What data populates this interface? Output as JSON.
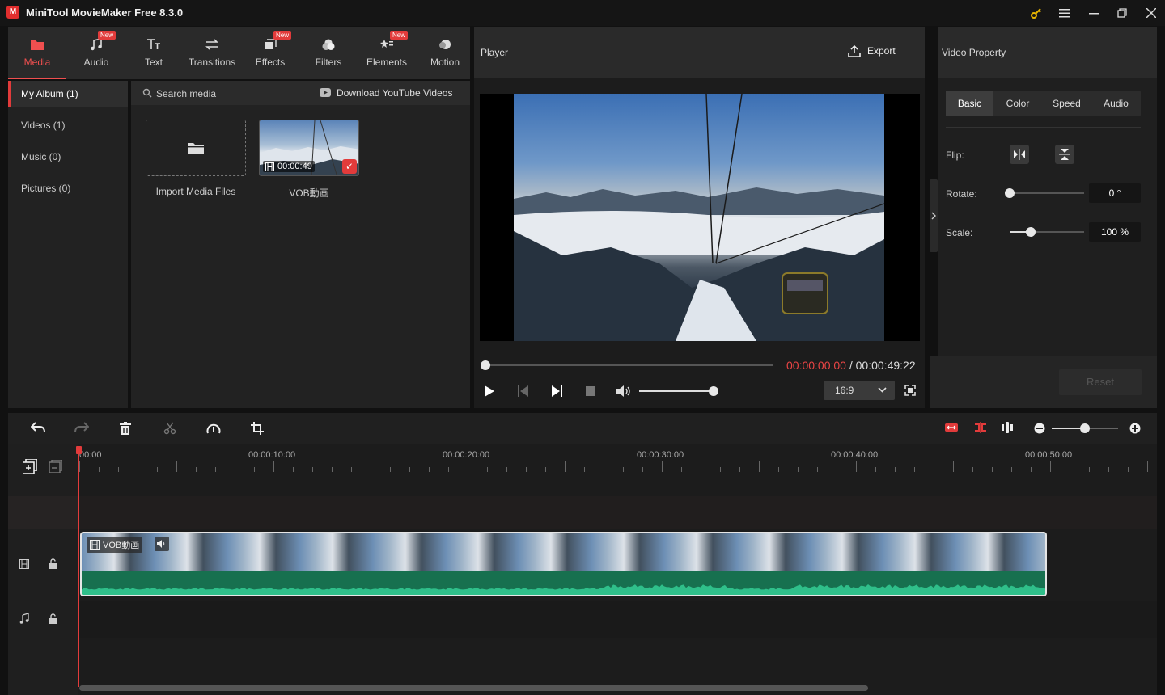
{
  "app": {
    "title": "MiniTool MovieMaker Free 8.3.0",
    "logo_letter": "M"
  },
  "window_controls": {
    "key": "key-icon",
    "menu": "menu-icon",
    "minimize": "minimize-icon",
    "maximize": "maximize-icon",
    "close": "close-icon"
  },
  "toolbar": {
    "items": [
      {
        "label": "Media",
        "icon": "media-icon",
        "new": false,
        "active": true
      },
      {
        "label": "Audio",
        "icon": "music-icon",
        "new": true,
        "active": false
      },
      {
        "label": "Text",
        "icon": "text-icon",
        "new": false,
        "active": false
      },
      {
        "label": "Transitions",
        "icon": "transitions-icon",
        "new": false,
        "active": false
      },
      {
        "label": "Effects",
        "icon": "effects-icon",
        "new": true,
        "active": false
      },
      {
        "label": "Filters",
        "icon": "filters-icon",
        "new": false,
        "active": false
      },
      {
        "label": "Elements",
        "icon": "elements-icon",
        "new": true,
        "active": false
      },
      {
        "label": "Motion",
        "icon": "motion-icon",
        "new": false,
        "active": false
      }
    ],
    "new_badge": "New"
  },
  "sidebar": {
    "items": [
      {
        "label": "My Album (1)",
        "active": true
      },
      {
        "label": "Videos (1)",
        "active": false
      },
      {
        "label": "Music (0)",
        "active": false
      },
      {
        "label": "Pictures (0)",
        "active": false
      }
    ]
  },
  "media": {
    "search_placeholder": "Search media",
    "download_label": "Download YouTube Videos",
    "import_label": "Import Media Files",
    "clip": {
      "name": "VOB動画",
      "duration": "00:00:49"
    }
  },
  "player": {
    "title": "Player",
    "export_label": "Export",
    "time_current": "00:00:00:00",
    "time_sep": " / ",
    "time_total": "00:00:49:22",
    "aspect": "16:9",
    "progress": 0,
    "volume": 1.0
  },
  "property": {
    "title": "Video Property",
    "tabs": [
      {
        "label": "Basic",
        "active": true
      },
      {
        "label": "Color",
        "active": false
      },
      {
        "label": "Speed",
        "active": false
      },
      {
        "label": "Audio",
        "active": false
      }
    ],
    "flip_label": "Flip:",
    "rotate_label": "Rotate:",
    "rotate_value": "0 °",
    "scale_label": "Scale:",
    "scale_value": "100 %",
    "reset_label": "Reset",
    "rotate_level": 0,
    "scale_level": 0.28
  },
  "timeline": {
    "ruler_labels": [
      "00:00",
      "00:00:10:00",
      "00:00:20:00",
      "00:00:30:00",
      "00:00:40:00",
      "00:00:50:00"
    ],
    "clip_name": "VOB動画",
    "zoom_level": 0.5,
    "colors": {
      "accent": "#e23b3b",
      "audio_wave": "#2fbf8a",
      "audio_bg": "#17704f"
    }
  }
}
